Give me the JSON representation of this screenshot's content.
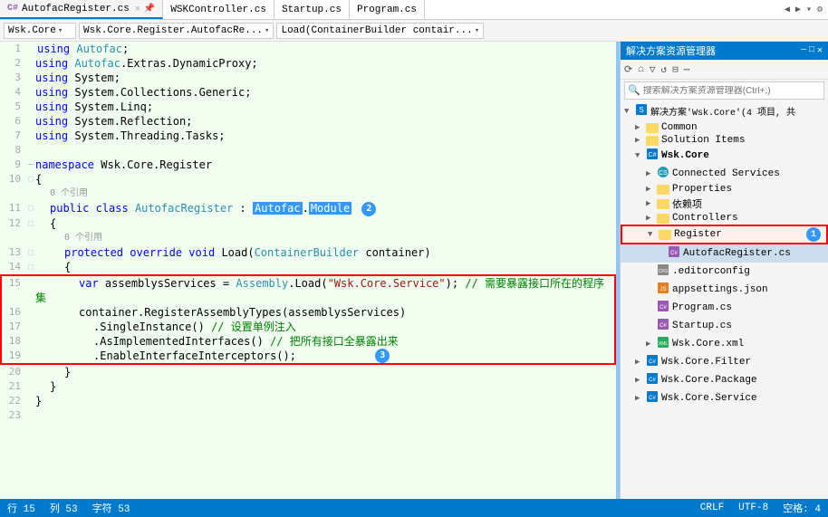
{
  "tabs": [
    {
      "id": "autofac",
      "label": "AutofacRegister.cs",
      "active": true,
      "modified": false
    },
    {
      "id": "wsk",
      "label": "WSKController.cs",
      "active": false
    },
    {
      "id": "startup",
      "label": "Startup.cs",
      "active": false
    },
    {
      "id": "program",
      "label": "Program.cs",
      "active": false
    }
  ],
  "toolbar": {
    "dropdown1": "Wsk.Core",
    "dropdown2": "Wsk.Core.Register.AutofacRe...",
    "dropdown3": "Load(ContainerBuilder contair..."
  },
  "code": {
    "lines": [
      {
        "num": 1,
        "indent": 0,
        "content": "using Autofac;",
        "type": "using"
      },
      {
        "num": 2,
        "indent": 0,
        "content": "using Autofac.Extras.DynamicProxy;",
        "type": "using"
      },
      {
        "num": 3,
        "indent": 0,
        "content": "using System;",
        "type": "using"
      },
      {
        "num": 4,
        "indent": 0,
        "content": "using System.Collections.Generic;",
        "type": "using"
      },
      {
        "num": 5,
        "indent": 0,
        "content": "using System.Linq;",
        "type": "using"
      },
      {
        "num": 6,
        "indent": 0,
        "content": "using System.Reflection;",
        "type": "using"
      },
      {
        "num": 7,
        "indent": 0,
        "content": "using System.Threading.Tasks;",
        "type": "using"
      },
      {
        "num": 8,
        "indent": 0,
        "content": "",
        "type": "blank"
      },
      {
        "num": 9,
        "indent": 0,
        "content": "namespace Wsk.Core.Register",
        "type": "ns"
      },
      {
        "num": 10,
        "indent": 0,
        "content": "{",
        "type": "brace"
      },
      {
        "num": 11,
        "indent": 1,
        "content": "public class AutofacRegister : Autofac.Module",
        "type": "class",
        "refs": "0 个引用"
      },
      {
        "num": 12,
        "indent": 1,
        "content": "{",
        "type": "brace"
      },
      {
        "num": 13,
        "indent": 2,
        "content": "protected override void Load(ContainerBuilder container)",
        "type": "method",
        "refs": "0 个引用"
      },
      {
        "num": 14,
        "indent": 2,
        "content": "{",
        "type": "brace"
      },
      {
        "num": 15,
        "indent": 3,
        "content": "var assemblysServices = Assembly.Load(\"Wsk.Core.Service\"); // 需要暴露接口所在的程序集",
        "type": "code"
      },
      {
        "num": 16,
        "indent": 3,
        "content": "container.RegisterAssemblyTypes(assemblysServices)",
        "type": "code"
      },
      {
        "num": 17,
        "indent": 4,
        "content": ".SingleInstance() // 设置单例注入",
        "type": "code"
      },
      {
        "num": 18,
        "indent": 4,
        "content": ".AsImplementedInterfaces() // 把所有接口全暴露出来",
        "type": "code"
      },
      {
        "num": 19,
        "indent": 4,
        "content": ".EnableInterfaceInterceptors();",
        "type": "code"
      },
      {
        "num": 20,
        "indent": 2,
        "content": "}",
        "type": "brace"
      },
      {
        "num": 21,
        "indent": 1,
        "content": "}",
        "type": "brace"
      },
      {
        "num": 22,
        "indent": 0,
        "content": "}",
        "type": "brace"
      },
      {
        "num": 23,
        "indent": 0,
        "content": "",
        "type": "blank"
      }
    ]
  },
  "solution_explorer": {
    "title": "解决方案资源管理器",
    "search_placeholder": "搜索解决方案资源管理器(Ctrl+;)",
    "solution_label": "解决方案'Wsk.Core'(4 项目, 共",
    "items": [
      {
        "id": "common",
        "label": "Common",
        "level": 1,
        "type": "folder",
        "expanded": false,
        "arrow": "▶"
      },
      {
        "id": "solution-items",
        "label": "Solution Items",
        "level": 1,
        "type": "folder",
        "expanded": false,
        "arrow": "▶"
      },
      {
        "id": "wsk-core",
        "label": "Wsk.Core",
        "level": 1,
        "type": "project",
        "expanded": true,
        "arrow": "▼"
      },
      {
        "id": "connected-services",
        "label": "Connected Services",
        "level": 2,
        "type": "folder",
        "expanded": false,
        "arrow": "▶"
      },
      {
        "id": "properties",
        "label": "Properties",
        "level": 2,
        "type": "folder",
        "expanded": false,
        "arrow": "▶"
      },
      {
        "id": "depends",
        "label": "依赖项",
        "level": 2,
        "type": "folder",
        "expanded": false,
        "arrow": "▶"
      },
      {
        "id": "controllers",
        "label": "Controllers",
        "level": 2,
        "type": "folder",
        "expanded": false,
        "arrow": "▶"
      },
      {
        "id": "register",
        "label": "Register",
        "level": 2,
        "type": "folder",
        "expanded": true,
        "arrow": "▼",
        "highlighted": true
      },
      {
        "id": "autofacregister",
        "label": "AutofacRegister.cs",
        "level": 3,
        "type": "cs",
        "expanded": false,
        "arrow": ""
      },
      {
        "id": "editorconfig",
        "label": ".editorconfig",
        "level": 2,
        "type": "config",
        "expanded": false,
        "arrow": ""
      },
      {
        "id": "appsettings",
        "label": "appsettings.json",
        "level": 2,
        "type": "json",
        "expanded": false,
        "arrow": ""
      },
      {
        "id": "program-cs",
        "label": "Program.cs",
        "level": 2,
        "type": "cs",
        "expanded": false,
        "arrow": ""
      },
      {
        "id": "startup-cs",
        "label": "Startup.cs",
        "level": 2,
        "type": "cs",
        "expanded": false,
        "arrow": ""
      },
      {
        "id": "wsk-core-xml",
        "label": "Wsk.Core.xml",
        "level": 2,
        "type": "xml",
        "expanded": false,
        "arrow": "▶"
      },
      {
        "id": "wsk-core-filter",
        "label": "Wsk.Core.Filter",
        "level": 1,
        "type": "project",
        "expanded": false,
        "arrow": "▶"
      },
      {
        "id": "wsk-core-package",
        "label": "Wsk.Core.Package",
        "level": 1,
        "type": "project",
        "expanded": false,
        "arrow": "▶"
      },
      {
        "id": "wsk-core-service",
        "label": "Wsk.Core.Service",
        "level": 1,
        "type": "project",
        "expanded": false,
        "arrow": "▶"
      }
    ]
  },
  "badges": {
    "badge1": "1",
    "badge2": "2",
    "badge3": "3"
  },
  "status": {
    "items": [
      "行 15",
      "列 53",
      "字符 53",
      "CRLF",
      "UTF-8",
      "空格: 4"
    ]
  }
}
